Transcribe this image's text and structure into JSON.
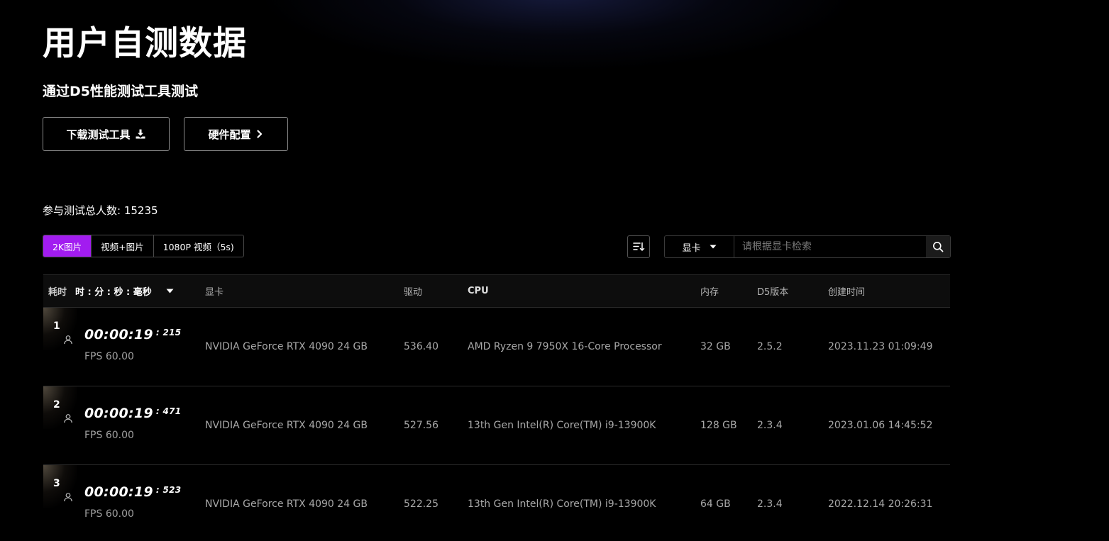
{
  "header": {
    "title": "用户自测数据",
    "subtitle": "通过D5性能测试工具测试",
    "download_label": "下载测试工具",
    "hardware_label": "硬件配置"
  },
  "stats": {
    "total_label": "参与测试总人数: 15235"
  },
  "tabs": [
    {
      "label": "2K图片",
      "active": true
    },
    {
      "label": "视频+图片",
      "active": false
    },
    {
      "label": "1080P 视频（5s)",
      "active": false
    }
  ],
  "search": {
    "field_label": "显卡",
    "placeholder": "请根据显卡检索"
  },
  "table": {
    "headers": {
      "time": "耗时",
      "time_format": "时 : 分 : 秒 : 毫秒",
      "gpu": "显卡",
      "driver": "驱动",
      "cpu": "CPU",
      "memory": "内存",
      "version": "D5版本",
      "created": "创建时间"
    },
    "rows": [
      {
        "rank": "1",
        "time": "00:00:19",
        "ms": ": 215",
        "fps": "FPS 60.00",
        "gpu": "NVIDIA GeForce RTX 4090 24 GB",
        "driver": "536.40",
        "cpu": "AMD Ryzen 9 7950X 16-Core Processor",
        "memory": "32 GB",
        "version": "2.5.2",
        "created": "2023.11.23 01:09:49"
      },
      {
        "rank": "2",
        "time": "00:00:19",
        "ms": ": 471",
        "fps": "FPS 60.00",
        "gpu": "NVIDIA GeForce RTX 4090 24 GB",
        "driver": "527.56",
        "cpu": "13th Gen Intel(R) Core(TM) i9-13900K",
        "memory": "128 GB",
        "version": "2.3.4",
        "created": "2023.01.06 14:45:52"
      },
      {
        "rank": "3",
        "time": "00:00:19",
        "ms": ": 523",
        "fps": "FPS 60.00",
        "gpu": "NVIDIA GeForce RTX 4090 24 GB",
        "driver": "522.25",
        "cpu": "13th Gen Intel(R) Core(TM) i9-13900K",
        "memory": "64 GB",
        "version": "2.3.4",
        "created": "2022.12.14 20:26:31"
      }
    ]
  },
  "colors": {
    "accent": "#a21cf0",
    "background": "#000000"
  },
  "icons": {
    "download": "download-icon",
    "chevron": "chevron-right-icon",
    "sort": "sort-icon",
    "caret": "caret-down-icon",
    "search": "search-icon",
    "user": "user-icon"
  }
}
